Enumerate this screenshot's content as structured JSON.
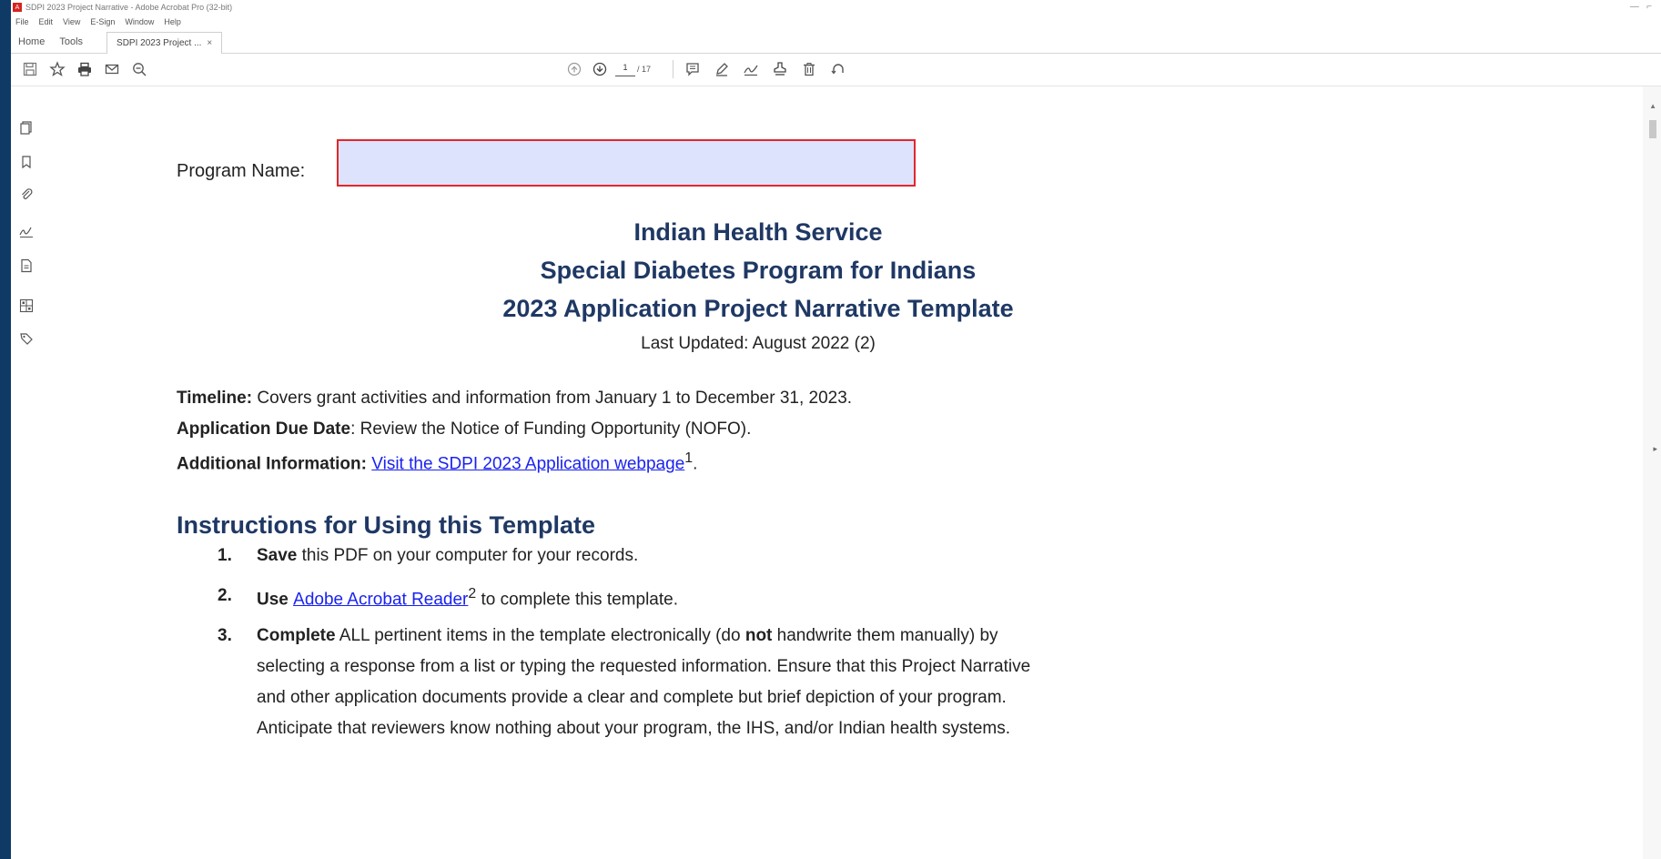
{
  "window": {
    "title": "SDPI 2023 Project Narrative - Adobe Acrobat Pro (32-bit)"
  },
  "menu": {
    "items": [
      "File",
      "Edit",
      "View",
      "E-Sign",
      "Window",
      "Help"
    ]
  },
  "tabs": {
    "home": "Home",
    "tools": "Tools",
    "document": "SDPI 2023 Project ...",
    "close_glyph": "×"
  },
  "toolbar": {
    "page_current": "1",
    "page_total": "/ 17"
  },
  "document": {
    "program_name_label": "Program Name:",
    "program_name_value": "",
    "org_title": "Indian Health Service",
    "program_title": "Special Diabetes Program for Indians",
    "template_title": "2023 Application Project Narrative Template",
    "last_updated": "Last Updated: August 2022 (2)",
    "timeline_label": "Timeline:",
    "timeline_text": " Covers grant activities and information from January 1 to December 31, 2023.",
    "due_label": "Application Due Date",
    "due_text": ": Review the Notice of Funding Opportunity (NOFO).",
    "addl_label": "Additional Information: ",
    "addl_link": "Visit the SDPI 2023 Application webpage",
    "addl_sup": "1",
    "addl_end": ".",
    "instructions_heading": "Instructions for Using this Template",
    "item1_num": "1.",
    "item1_bold": "Save",
    "item1_text": " this PDF on your computer for your records.",
    "item2_num": "2.",
    "item2_bold": "Use ",
    "item2_link": "Adobe Acrobat Reader",
    "item2_sup": "2",
    "item2_text": " to complete this template.",
    "item3_num": "3.",
    "item3_bold": "Complete",
    "item3_text_a": " ALL pertinent items in the template electronically (do ",
    "item3_not": "not",
    "item3_text_b": " handwrite them manually) by",
    "item3_line2": "selecting a response from a list or typing the requested information. Ensure that this Project Narrative",
    "item3_line3": "and other application documents provide a clear and complete but brief depiction of your program.",
    "item3_line4": "Anticipate that reviewers know nothing about your program, the IHS, and/or Indian health systems."
  }
}
